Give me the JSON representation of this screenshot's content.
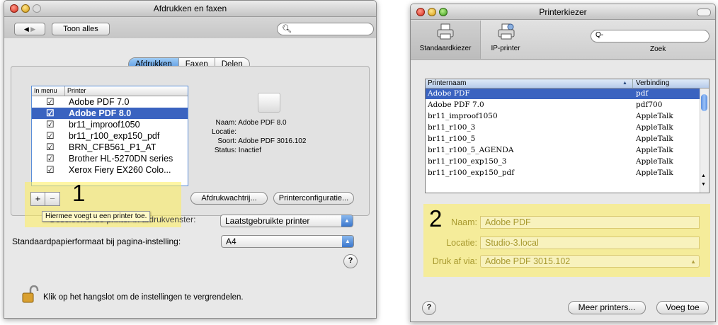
{
  "left_window": {
    "title": "Afdrukken en faxen",
    "show_all": "Toon alles",
    "search_placeholder": "",
    "tabs": [
      "Afdrukken",
      "Faxen",
      "Delen"
    ],
    "selected_tab": "Afdrukken",
    "list_headers": {
      "in_menu": "In menu",
      "printer": "Printer"
    },
    "printers": [
      {
        "name": "Adobe PDF 7.0",
        "checked": true,
        "selected": false
      },
      {
        "name": "Adobe PDF 8.0",
        "checked": true,
        "selected": true
      },
      {
        "name": "br11_improof1050",
        "checked": true,
        "selected": false
      },
      {
        "name": "br11_r100_exp150_pdf",
        "checked": true,
        "selected": false
      },
      {
        "name": "BRN_CFB561_P1_AT",
        "checked": true,
        "selected": false
      },
      {
        "name": "Brother HL-5270DN series",
        "checked": true,
        "selected": false
      },
      {
        "name": "Xerox Fiery EX260 Colo...",
        "checked": true,
        "selected": false
      }
    ],
    "info": {
      "name_label": "Naam:",
      "name_value": "Adobe PDF 8.0",
      "location_label": "Locatie:",
      "location_value": "",
      "kind_label": "Soort:",
      "kind_value": "Adobe PDF 3016.102",
      "status_label": "Status:",
      "status_value": "Inactief"
    },
    "add_symbol": "+",
    "remove_symbol": "−",
    "callout_number": "1",
    "tooltip": "Hiermee voegt u een printer toe.",
    "queue_button": "Afdrukwachtrij...",
    "config_button": "Printerconfiguratie...",
    "selected_printer_label_visible": "Geselecteerde printer in afdrukvenster:",
    "selected_printer_value": "Laatstgebruikte printer",
    "paper_label": "Standaardpapierformaat bij pagina-instelling:",
    "paper_value": "A4",
    "help": "?",
    "lock_text": "Klik op het hangslot om de instellingen te vergrendelen."
  },
  "right_window": {
    "title": "Printerkiezer",
    "toolbar": [
      {
        "label": "Standaardkiezer",
        "icon": "printer-icon"
      },
      {
        "label": "IP-printer",
        "icon": "network-printer-icon"
      }
    ],
    "search_placeholder": "Q-",
    "search_label": "Zoek",
    "table_headers": {
      "name": "Printernaam",
      "connection": "Verbinding"
    },
    "printers": [
      {
        "name": "Adobe PDF",
        "connection": "pdf",
        "selected": true
      },
      {
        "name": "Adobe PDF 7.0",
        "connection": "pdf700",
        "selected": false
      },
      {
        "name": "br11_improof1050",
        "connection": "AppleTalk",
        "selected": false
      },
      {
        "name": "br11_r100_3",
        "connection": "AppleTalk",
        "selected": false
      },
      {
        "name": "br11_r100_5",
        "connection": "AppleTalk",
        "selected": false
      },
      {
        "name": "br11_r100_5_AGENDA",
        "connection": "AppleTalk",
        "selected": false
      },
      {
        "name": "br11_r100_exp150_3",
        "connection": "AppleTalk",
        "selected": false
      },
      {
        "name": "br11_r100_exp150_pdf",
        "connection": "AppleTalk",
        "selected": false
      }
    ],
    "callout_number": "2",
    "name_label": "Naam:",
    "name_value": "Adobe PDF",
    "location_label": "Locatie:",
    "location_value": "Studio-3.local",
    "print_via_label": "Druk af via:",
    "print_via_value": "Adobe PDF 3015.102",
    "help": "?",
    "more_printers": "Meer printers...",
    "add_button": "Voeg toe"
  },
  "colors": {
    "highlight": "#fff05a",
    "selection": "#3a63c0",
    "accent": "#4a8fe0"
  }
}
